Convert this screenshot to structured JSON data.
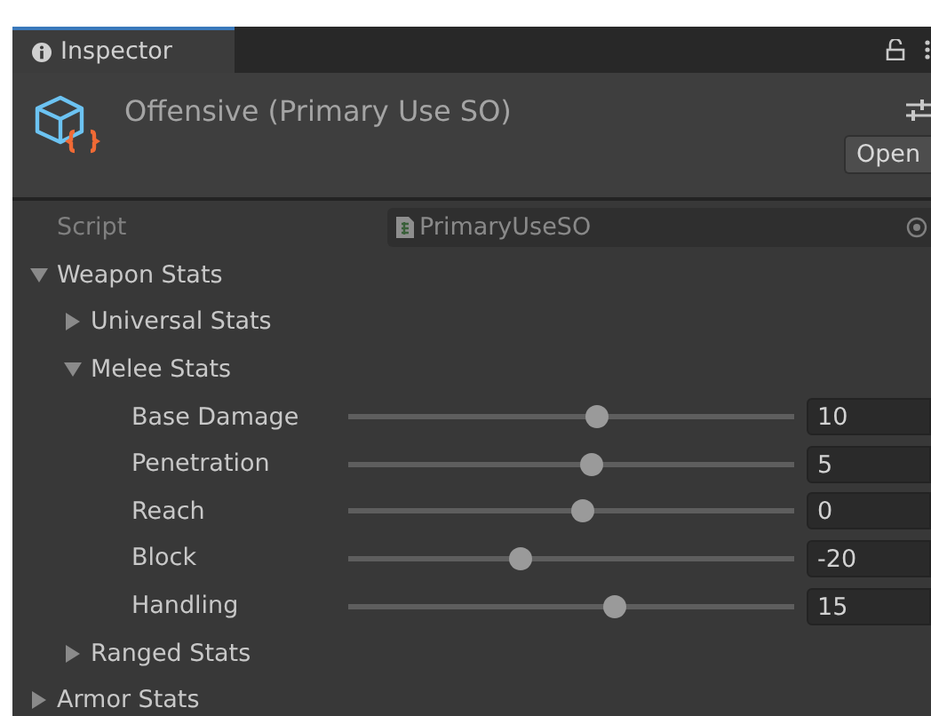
{
  "tab": {
    "label": "Inspector",
    "selected": true
  },
  "header": {
    "title": "Offensive (Primary Use SO)",
    "open_button": "Open"
  },
  "properties": [
    {
      "kind": "script",
      "label": "Script",
      "value": "PrimaryUseSO",
      "disabled": true
    },
    {
      "kind": "foldout",
      "label": "Weapon Stats",
      "expanded": true,
      "children": [
        {
          "kind": "foldout",
          "label": "Universal Stats",
          "expanded": false
        },
        {
          "kind": "foldout",
          "label": "Melee Stats",
          "expanded": true,
          "children": [
            {
              "kind": "slider",
              "label": "Base Damage",
              "level": 0.53,
              "value": "10"
            },
            {
              "kind": "slider",
              "label": "Penetration",
              "level": 0.52,
              "value": "5"
            },
            {
              "kind": "slider",
              "label": "Reach",
              "level": 0.5,
              "value": "0"
            },
            {
              "kind": "slider",
              "label": "Block",
              "level": 0.36,
              "value": "-20"
            },
            {
              "kind": "slider",
              "label": "Handling",
              "level": 0.57,
              "value": "15"
            }
          ]
        },
        {
          "kind": "foldout",
          "label": "Ranged Stats",
          "expanded": false
        }
      ]
    },
    {
      "kind": "foldout",
      "label": "Armor Stats",
      "expanded": false
    }
  ]
}
